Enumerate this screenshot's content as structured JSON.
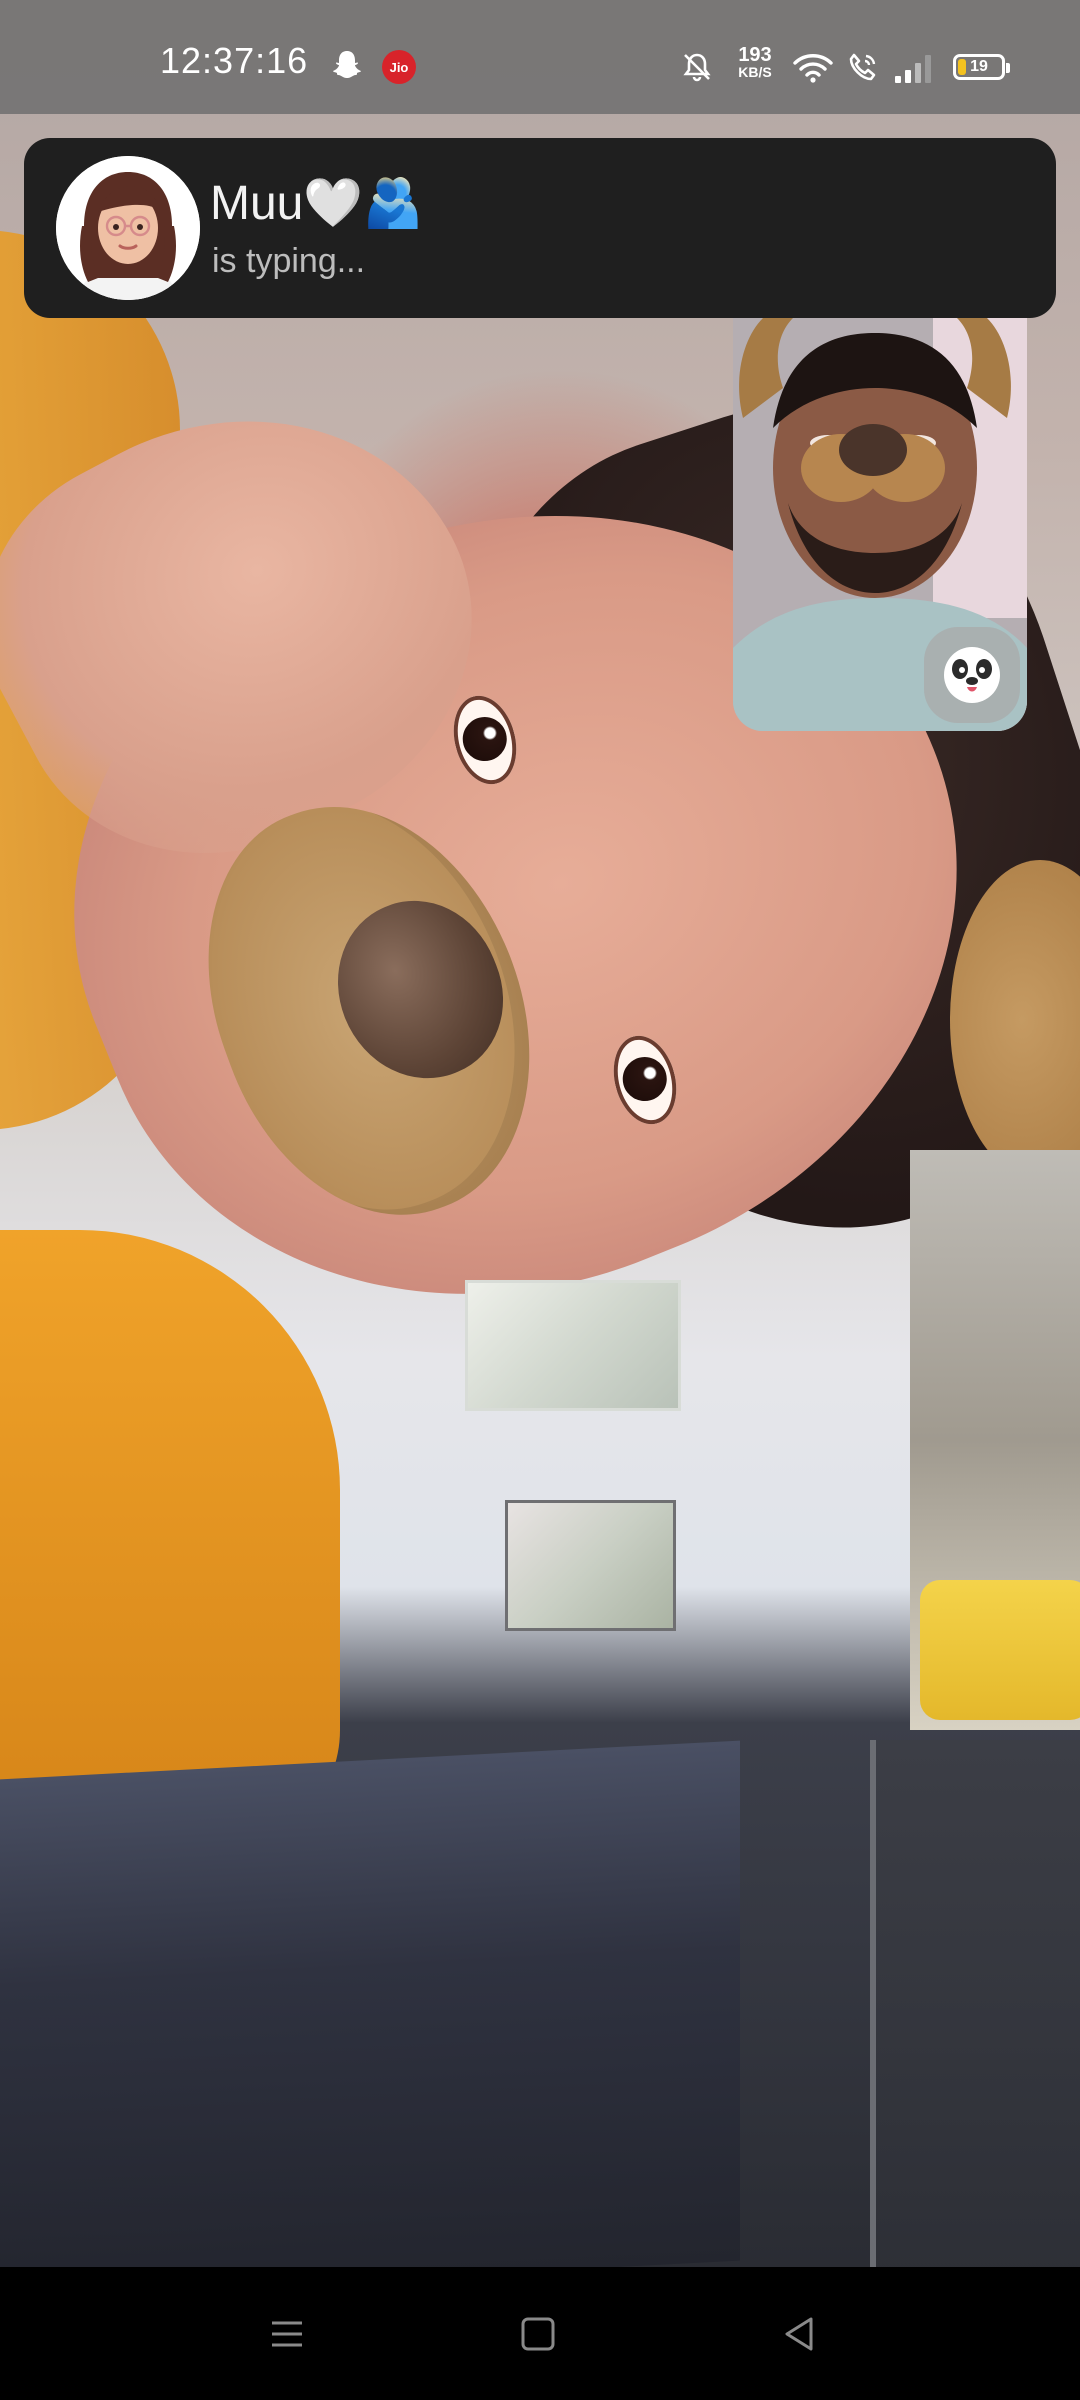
{
  "status_bar": {
    "time": "12:37:16",
    "carrier_badge": "Jio",
    "net_speed_value": "193",
    "net_speed_unit": "KB/S",
    "battery_level": "19",
    "battery_fraction": 0.19,
    "icons": [
      "snapchat-ghost-icon",
      "jio-icon",
      "bell-muted-icon",
      "wifi-icon",
      "wifi-calling-icon",
      "signal-icon",
      "battery-icon"
    ]
  },
  "notification": {
    "name": "Muu🤍🫂",
    "status": "is typing..."
  },
  "call": {
    "lens_icon": "dog-lens-icon"
  },
  "nav_bar": {
    "icons": [
      "menu-icon",
      "home-icon",
      "back-icon"
    ]
  },
  "colors": {
    "banner_bg": "#1f1f1f",
    "jio_red": "#d8232a",
    "battery_yellow": "#f4c21f"
  }
}
